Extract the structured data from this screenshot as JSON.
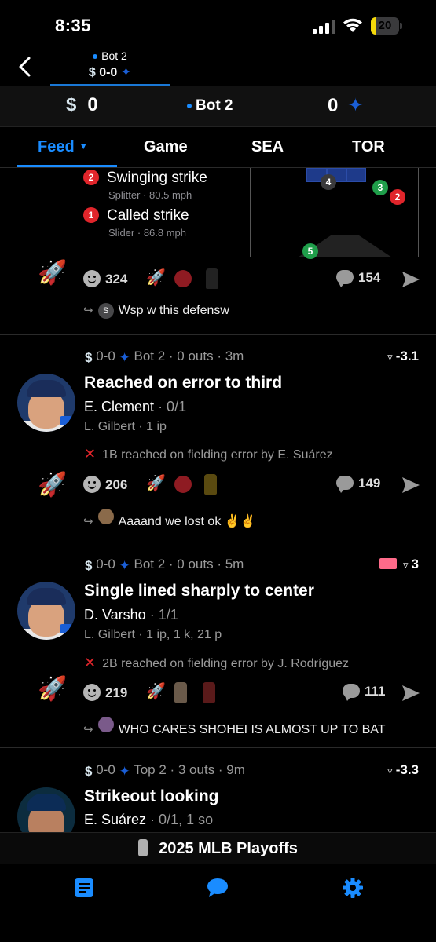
{
  "status_bar": {
    "time": "8:35",
    "battery": "20",
    "battery_level": 0.2
  },
  "header": {
    "mini_inning": "Bot 2",
    "mini_score": "0-0",
    "score_left": "0",
    "inning": "Bot 2",
    "score_right": "0",
    "team_left_icon": "mariners-logo-icon",
    "team_right_icon": "blue-jays-logo-icon"
  },
  "tabs": [
    {
      "label": "Feed",
      "active": true
    },
    {
      "label": "Game"
    },
    {
      "label": "SEA"
    },
    {
      "label": "TOR"
    }
  ],
  "pitch_card": {
    "pitches": [
      {
        "num": "2",
        "result": "Swinging strike",
        "type": "Splitter",
        "speed": "80.5 mph"
      },
      {
        "num": "1",
        "result": "Called strike",
        "type": "Slider",
        "speed": "86.8 mph"
      }
    ],
    "zone_balls": [
      {
        "num": "4",
        "color": "#3a3a3c"
      },
      {
        "num": "3",
        "color": "#1f9e4a"
      },
      {
        "num": "2",
        "color": "#e0252b"
      },
      {
        "num": "5",
        "color": "#1f9e4a"
      }
    ],
    "reactions": "324",
    "comments": "154",
    "reply": {
      "avatar_letter": "S",
      "text": "Wsp w this defensw"
    }
  },
  "cards": [
    {
      "score": "0-0",
      "meta": "Bot 2 · 0 outs · 3m",
      "win_prob": "-3.1",
      "title": "Reached on error to third",
      "batter": "E. Clement",
      "batter_stat": "· 0/1",
      "pitcher": "L. Gilbert · 1 ip",
      "detail": "1B reached on fielding error by E. Suárez",
      "reactions": "206",
      "comments": "149",
      "reply": "Aaaand we lost ok ✌️✌️"
    },
    {
      "score": "0-0",
      "meta": "Bot 2 · 0 outs · 5m",
      "win_prob": "3",
      "title": "Single lined sharply to center",
      "batter": "D. Varsho",
      "batter_stat": "· 1/1",
      "pitcher": "L. Gilbert · 1 ip, 1 k, 21 p",
      "detail": "2B reached on fielding error by J. Rodríguez",
      "reactions": "219",
      "comments": "111",
      "reply": "WHO CARES SHOHEI IS ALMOST UP TO BAT"
    },
    {
      "score": "0-0",
      "meta": "Top 2 · 3 outs · 9m",
      "win_prob": "-3.3",
      "title": "Strikeout looking",
      "batter": "E. Suárez",
      "batter_stat": "· 0/1, 1 so"
    }
  ],
  "footer": {
    "banner": "2025 MLB Playoffs"
  },
  "bottom_nav": [
    {
      "icon": "feed-icon"
    },
    {
      "icon": "chat-icon"
    },
    {
      "icon": "settings-gear-icon"
    }
  ]
}
